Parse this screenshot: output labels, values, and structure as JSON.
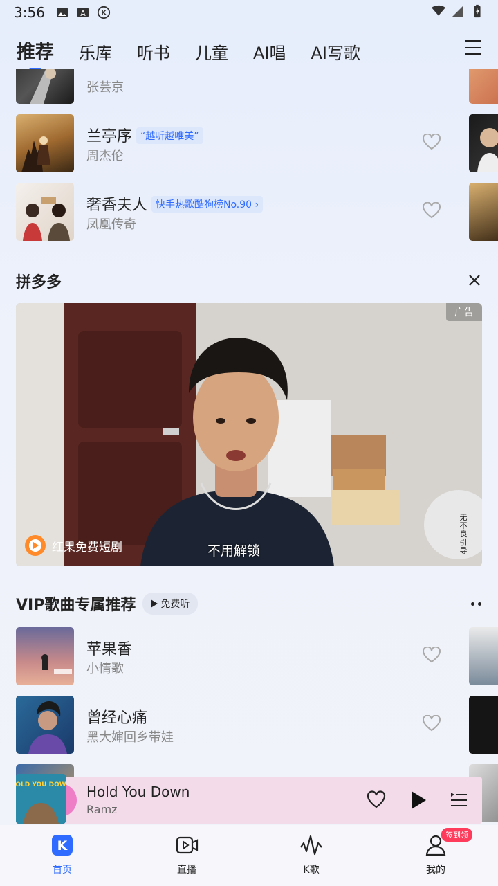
{
  "status_bar": {
    "time": "3:56"
  },
  "tabs": [
    {
      "label": "推荐",
      "active": true
    },
    {
      "label": "乐库"
    },
    {
      "label": "听书"
    },
    {
      "label": "儿童"
    },
    {
      "label": "AI唱"
    },
    {
      "label": "AI写歌"
    }
  ],
  "songs_top": [
    {
      "title": "",
      "artist": "张芸京",
      "tag": ""
    },
    {
      "title": "兰亭序",
      "artist": "周杰伦",
      "tag": "“越听越唯美”"
    },
    {
      "title": "奢香夫人",
      "artist": "凤凰传奇",
      "tag": "快手热歌酷狗榜No.90 ›"
    }
  ],
  "ad": {
    "section_title": "拼多多",
    "badge": "广告",
    "brand": "红果免费短剧",
    "subtitle": "不用解锁",
    "side_text": "无不良引导"
  },
  "vip": {
    "title": "VIP歌曲专属推荐",
    "free_label": "免费听",
    "songs": [
      {
        "title": "苹果香",
        "artist": "小情歌"
      },
      {
        "title": "曾经心痛",
        "artist": "黑大婶回乡带娃"
      }
    ]
  },
  "player": {
    "title": "Hold You Down",
    "artist": "Ramz"
  },
  "bottom_nav": [
    {
      "label": "首页",
      "active": true
    },
    {
      "label": "直播"
    },
    {
      "label": "K歌"
    },
    {
      "label": "我的"
    }
  ],
  "sign_badge": "签到领",
  "colors": {
    "accent": "#2f6bff",
    "player_bg": "#f3dbe9",
    "badge_red": "#ff3b5c"
  }
}
